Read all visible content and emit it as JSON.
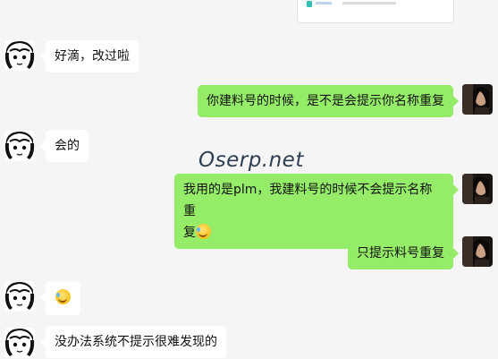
{
  "watermark": "Oserp.net",
  "messages": [
    {
      "side": "left",
      "text": "好滴，改过啦"
    },
    {
      "side": "right",
      "text": "你建料号的时候，是不是会提示你名称重复"
    },
    {
      "side": "left",
      "text": "会的"
    },
    {
      "side": "right",
      "line1": "我用的是plm，我建料号的时候不会提示名称重",
      "line2": "复",
      "emoji": "rolling-on-floor-laughing-emoji"
    },
    {
      "side": "right",
      "text": "只提示料号重复"
    },
    {
      "side": "left",
      "emoji": "rolling-on-floor-laughing-emoji"
    },
    {
      "side": "left",
      "text": "没办法系统不提示很难发现的"
    }
  ],
  "icons": {
    "left_avatar": "cartoon-avatar-icon",
    "right_avatar": "photo-avatar-icon"
  },
  "colors": {
    "background": "#f5f5f5",
    "bubble_left": "#ffffff",
    "bubble_right": "#95ec69"
  }
}
